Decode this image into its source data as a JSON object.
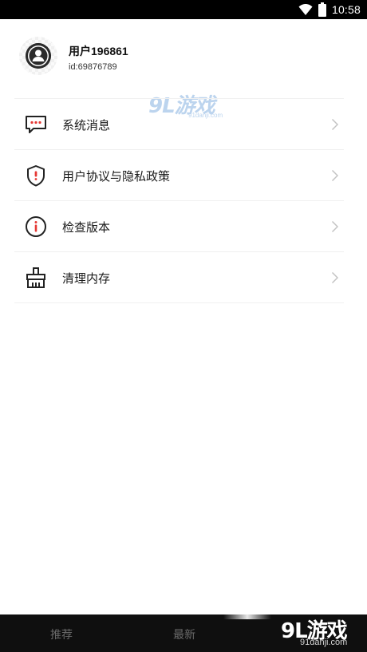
{
  "status_bar": {
    "time": "10:58",
    "icons": [
      "wifi-icon",
      "battery-icon"
    ]
  },
  "profile": {
    "username": "用户196861",
    "user_id": "id:69876789",
    "avatar_icon": "user-avatar-icon"
  },
  "watermark": {
    "logo": "9L游戏",
    "url": "91danji.com"
  },
  "menu": {
    "items": [
      {
        "label": "系统消息",
        "icon": "message-icon"
      },
      {
        "label": "用户协议与隐私政策",
        "icon": "shield-icon"
      },
      {
        "label": "检查版本",
        "icon": "info-icon"
      },
      {
        "label": "清理内存",
        "icon": "broom-icon"
      }
    ],
    "chevron_icon": "chevron-right-icon",
    "accent_color": "#e53935"
  },
  "bottom_bar": {
    "tabs": [
      {
        "label": "推荐"
      },
      {
        "label": "最新"
      }
    ],
    "logo": "9L游戏",
    "url": "91danji.com"
  }
}
